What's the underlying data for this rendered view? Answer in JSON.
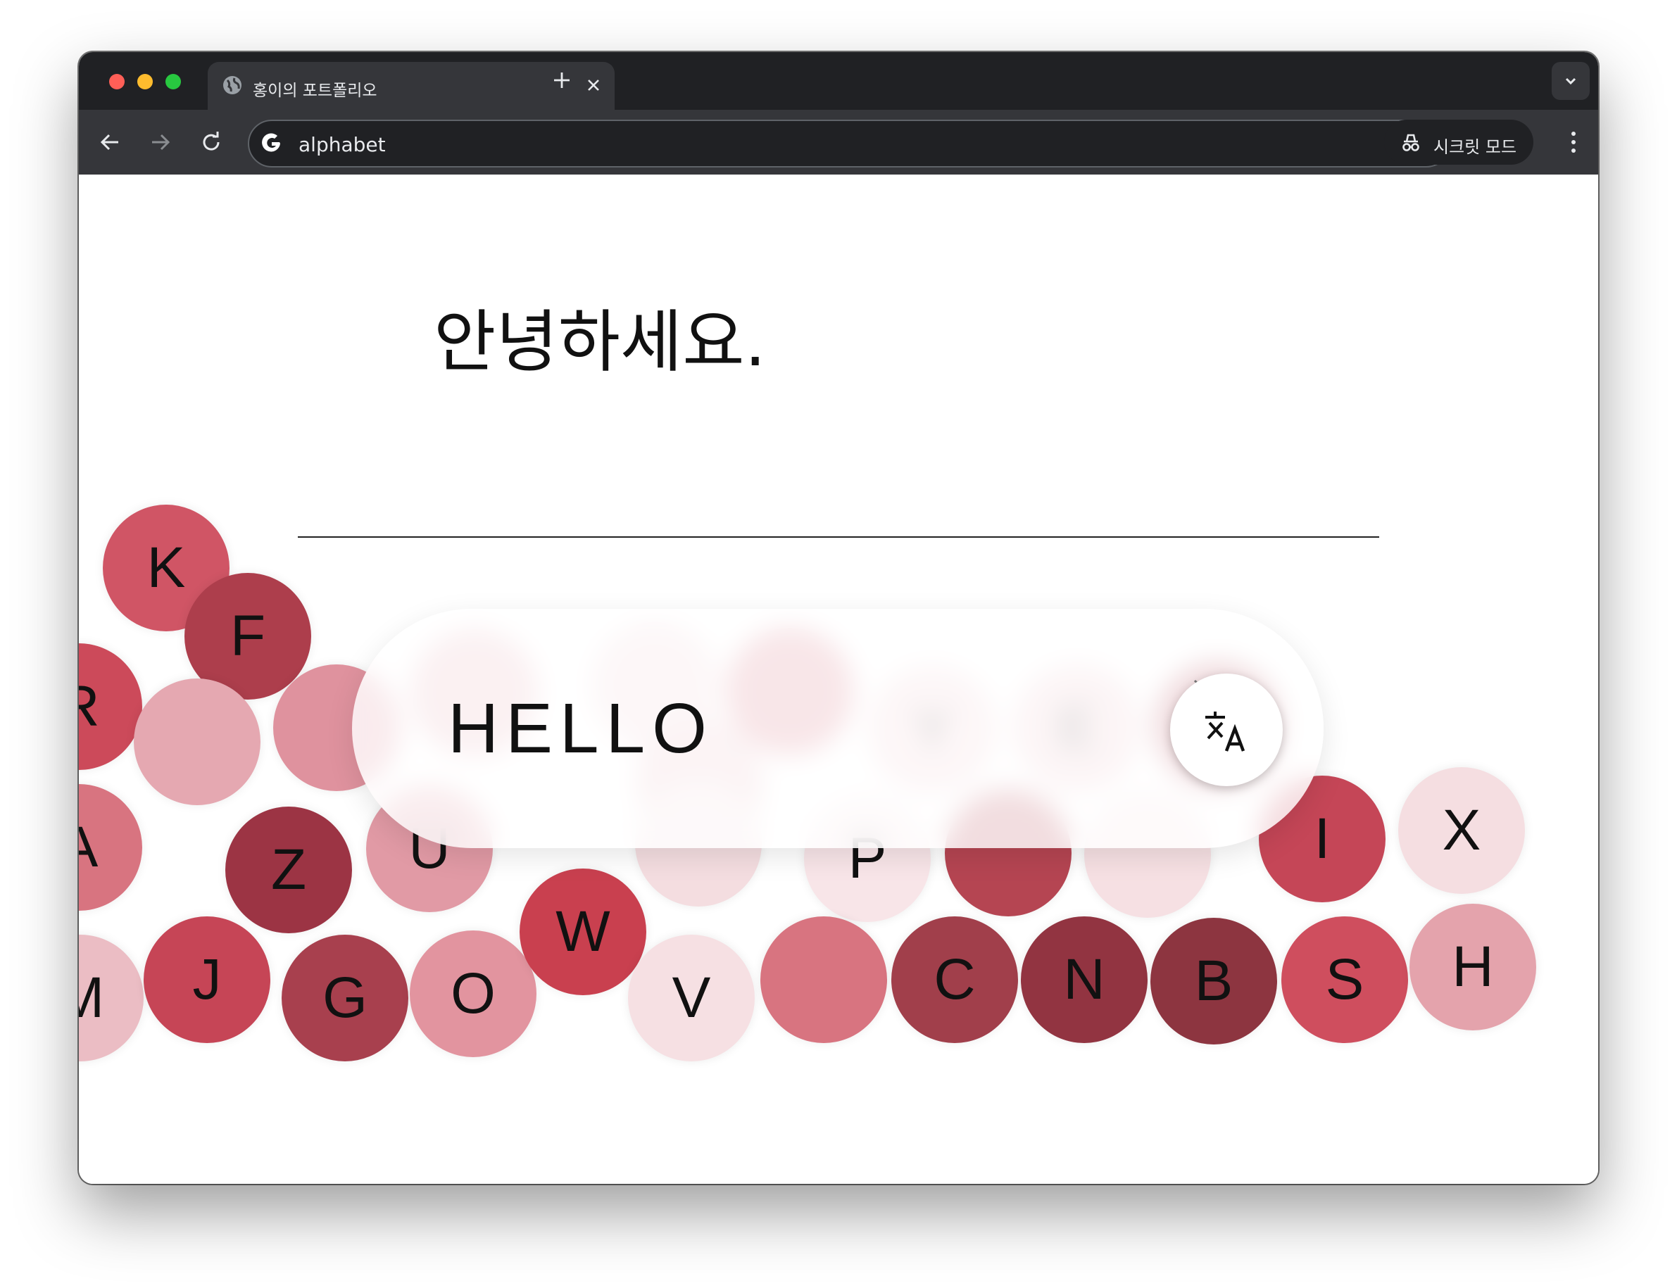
{
  "browser": {
    "tab_title": "홍이의 포트폴리오",
    "address": "alphabet",
    "incognito_label": "시크릿 모드"
  },
  "page": {
    "translation": "안녕하세요.",
    "input_value": "HELLO"
  },
  "bubbles": [
    {
      "letter": "K",
      "color": "#d05565"
    },
    {
      "letter": "F",
      "color": "#ad3e4c"
    },
    {
      "letter": "R",
      "color": "#cc4a5a"
    },
    {
      "letter": "",
      "color": "#e5a8b1"
    },
    {
      "letter": "",
      "color": "#df929e"
    },
    {
      "letter": "",
      "color": "#e7b0b8"
    },
    {
      "letter": "",
      "color": "#f1d3d8"
    },
    {
      "letter": "",
      "color": "#ebc1c7"
    },
    {
      "letter": "",
      "color": "#d87582"
    },
    {
      "letter": "Y",
      "color": "#f2cfd4"
    },
    {
      "letter": "E",
      "color": "#efc8ce"
    },
    {
      "letter": "T",
      "color": "#ae3e4d"
    },
    {
      "letter": "A",
      "color": "#d87480"
    },
    {
      "letter": "Z",
      "color": "#9c3444"
    },
    {
      "letter": "U",
      "color": "#e19aa5"
    },
    {
      "letter": "",
      "color": "#f4dde0"
    },
    {
      "letter": "P",
      "color": "#f8e5e8"
    },
    {
      "letter": "",
      "color": "#b54552"
    },
    {
      "letter": "",
      "color": "#f6e0e3"
    },
    {
      "letter": "I",
      "color": "#c54657"
    },
    {
      "letter": "X",
      "color": "#f5dee1"
    },
    {
      "letter": "M",
      "color": "#ebbdc4"
    },
    {
      "letter": "J",
      "color": "#c64556"
    },
    {
      "letter": "G",
      "color": "#a8404e"
    },
    {
      "letter": "O",
      "color": "#e2949f"
    },
    {
      "letter": "W",
      "color": "#c9404f"
    },
    {
      "letter": "V",
      "color": "#f6e0e3"
    },
    {
      "letter": "",
      "color": "#d87480"
    },
    {
      "letter": "C",
      "color": "#a13f4b"
    },
    {
      "letter": "N",
      "color": "#923441"
    },
    {
      "letter": "B",
      "color": "#8d3540"
    },
    {
      "letter": "S",
      "color": "#cf4e5e"
    },
    {
      "letter": "H",
      "color": "#e4a3ac"
    }
  ]
}
